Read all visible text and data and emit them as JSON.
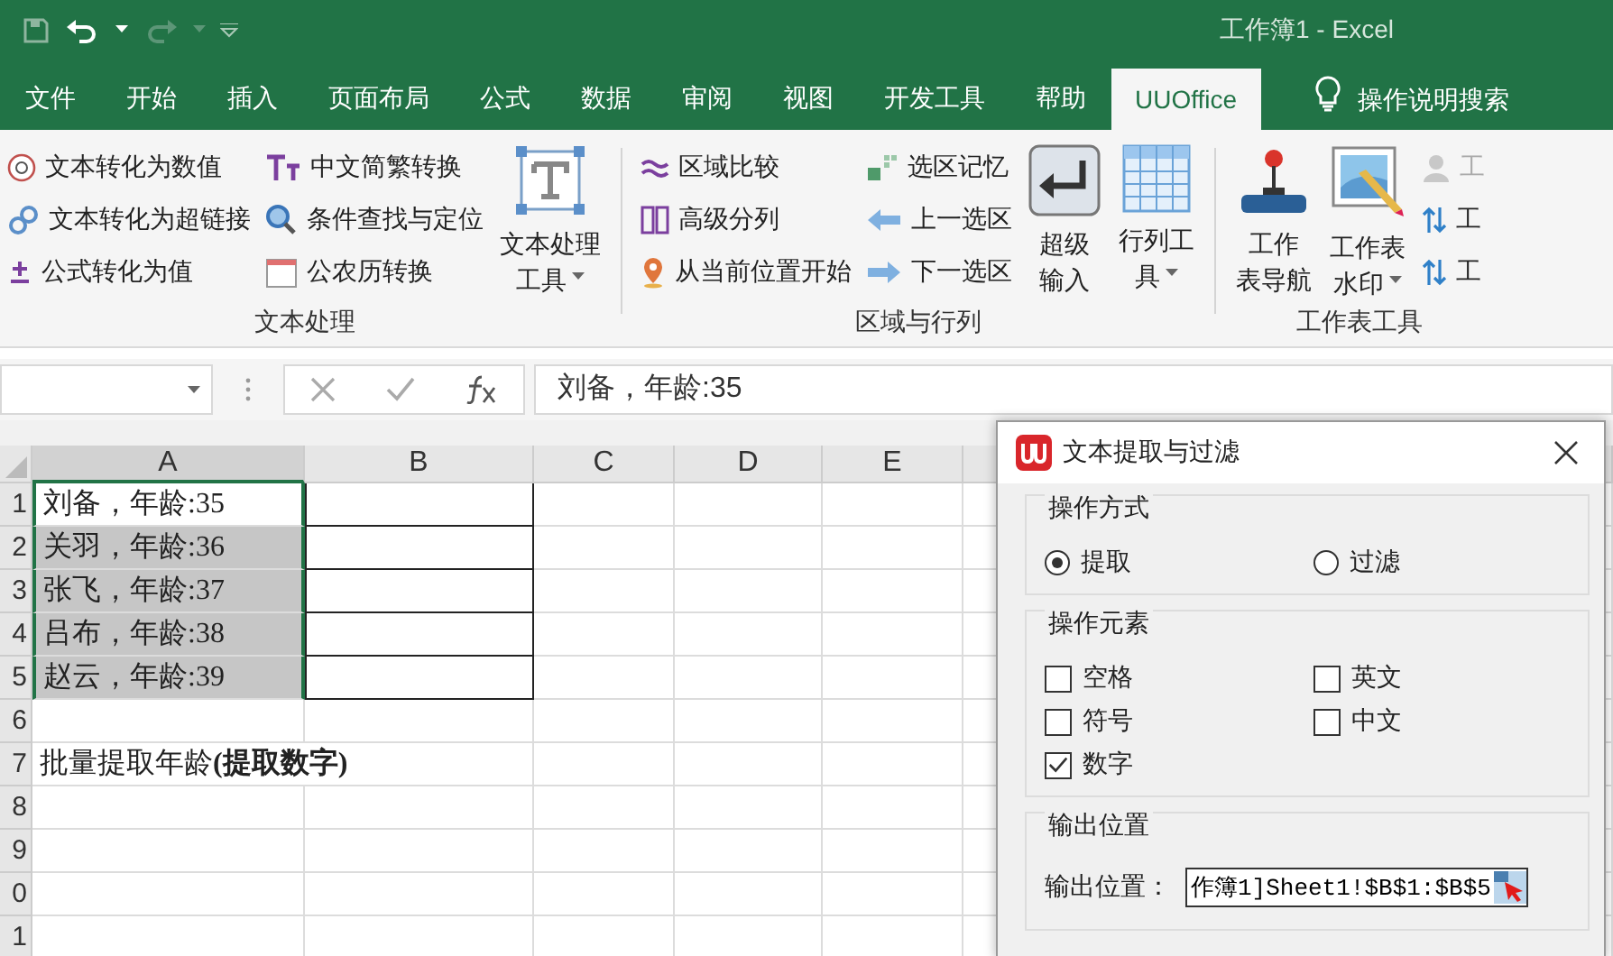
{
  "window": {
    "title": "工作簿1  -  Excel"
  },
  "tabs": [
    {
      "label": "文件",
      "selected": false
    },
    {
      "label": "开始",
      "selected": false
    },
    {
      "label": "插入",
      "selected": false
    },
    {
      "label": "页面布局",
      "selected": false
    },
    {
      "label": "公式",
      "selected": false
    },
    {
      "label": "数据",
      "selected": false
    },
    {
      "label": "审阅",
      "selected": false
    },
    {
      "label": "视图",
      "selected": false
    },
    {
      "label": "开发工具",
      "selected": false
    },
    {
      "label": "帮助",
      "selected": false
    },
    {
      "label": "UUOffice",
      "selected": true
    }
  ],
  "tell_me": "操作说明搜索",
  "ribbon": {
    "groups": [
      {
        "label": "文本处理",
        "columns": [
          {
            "kind": "stack",
            "items": [
              {
                "label": "文本转化为数值",
                "disabled": false
              },
              {
                "label": "文本转化为超链接",
                "disabled": false
              },
              {
                "label": "公式转化为值",
                "disabled": false
              }
            ]
          },
          {
            "kind": "stack",
            "items": [
              {
                "label": "中文简繁转换",
                "disabled": false
              },
              {
                "label": "条件查找与定位",
                "disabled": false
              },
              {
                "label": "公农历转换",
                "disabled": false
              }
            ]
          },
          {
            "kind": "large",
            "lines": [
              "文本处理",
              "工具"
            ],
            "dropdown": true
          }
        ]
      },
      {
        "label": "区域与行列",
        "columns": [
          {
            "kind": "stack",
            "items": [
              {
                "label": "区域比较",
                "disabled": false
              },
              {
                "label": "高级分列",
                "disabled": false
              },
              {
                "label": "从当前位置开始",
                "disabled": false
              }
            ]
          },
          {
            "kind": "stack",
            "items": [
              {
                "label": "选区记忆",
                "disabled": false
              },
              {
                "label": "上一选区",
                "disabled": false
              },
              {
                "label": "下一选区",
                "disabled": false
              }
            ]
          },
          {
            "kind": "large",
            "lines": [
              "超级",
              "输入"
            ],
            "dropdown": false
          },
          {
            "kind": "large",
            "lines": [
              "行列工",
              "具"
            ],
            "dropdown": true
          }
        ]
      },
      {
        "label": "工作表工具",
        "columns": [
          {
            "kind": "large",
            "lines": [
              "工作",
              "表导航"
            ],
            "dropdown": false
          },
          {
            "kind": "large",
            "lines": [
              "工作表",
              "水印"
            ],
            "dropdown": true
          },
          {
            "kind": "stack",
            "items": [
              {
                "label": "工",
                "disabled": true
              },
              {
                "label": "工",
                "disabled": false
              },
              {
                "label": "工",
                "disabled": false
              }
            ]
          }
        ]
      }
    ]
  },
  "formula_bar": {
    "value": "刘备，年龄:35"
  },
  "sheet": {
    "columns": [
      {
        "label": "A",
        "selected": true
      },
      {
        "label": "B",
        "selected": false
      },
      {
        "label": "C",
        "selected": false
      },
      {
        "label": "D",
        "selected": false
      },
      {
        "label": "E",
        "selected": false
      }
    ],
    "rows": [
      {
        "label": "1",
        "cells": [
          {
            "text": "刘备，年龄:35",
            "selected": false,
            "bordered": false
          },
          {
            "bordered": true
          }
        ]
      },
      {
        "label": "2",
        "cells": [
          {
            "text": "关羽，年龄:36",
            "selected": true,
            "bordered": false
          },
          {
            "bordered": true
          }
        ]
      },
      {
        "label": "3",
        "cells": [
          {
            "text": "张飞，年龄:37",
            "selected": true,
            "bordered": false
          },
          {
            "bordered": true
          }
        ]
      },
      {
        "label": "4",
        "cells": [
          {
            "text": "吕布，年龄:38",
            "selected": true,
            "bordered": false
          },
          {
            "bordered": true
          }
        ]
      },
      {
        "label": "5",
        "cells": [
          {
            "text": "赵云，年龄:39",
            "selected": true,
            "bordered": false
          },
          {
            "bordered": true
          }
        ]
      },
      {
        "label": "6",
        "cells": []
      },
      {
        "label": "7",
        "cells": [
          {
            "text": "批量提取年龄**(提取数字)**",
            "selected": false,
            "bordered": false
          }
        ]
      },
      {
        "label": "8",
        "cells": []
      },
      {
        "label": "9",
        "cells": []
      },
      {
        "label": "0",
        "cells": []
      },
      {
        "label": "1",
        "cells": []
      }
    ]
  },
  "dialog": {
    "title": "文本提取与过滤",
    "mode": {
      "label": "操作方式",
      "options": [
        {
          "label": "提取",
          "selected": true
        },
        {
          "label": "过滤",
          "selected": false
        }
      ]
    },
    "elements": {
      "label": "操作元素",
      "options": [
        {
          "label": "空格",
          "checked": false
        },
        {
          "label": "英文",
          "checked": false
        },
        {
          "label": "符号",
          "checked": false
        },
        {
          "label": "中文",
          "checked": false
        },
        {
          "label": "数字",
          "checked": true
        }
      ]
    },
    "output": {
      "label": "输出位置",
      "field_label": "输出位置：",
      "value": "作簿1]Sheet1!$B$1:$B$5"
    }
  }
}
